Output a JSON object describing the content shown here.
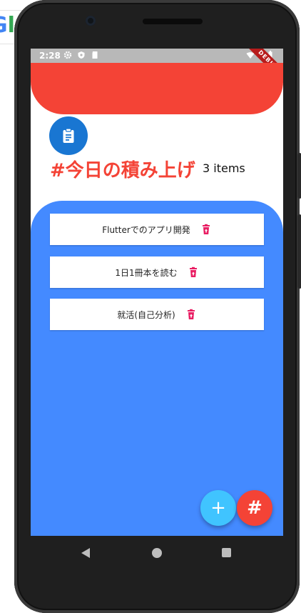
{
  "status_bar": {
    "time": "2:28",
    "debug_banner": "DEBUG"
  },
  "header": {
    "title": "#今日の積み上げ",
    "item_count": "3 items"
  },
  "tasks": [
    {
      "label": "Flutterでのアプリ開発"
    },
    {
      "label": "1日1冊本を読む"
    },
    {
      "label": "就活(自己分析)"
    }
  ],
  "fabs": {
    "add_symbol": "+",
    "hash_symbol": "#"
  },
  "colors": {
    "accent_red": "#f44336",
    "panel_blue": "#448aff",
    "avatar_blue": "#1976d2",
    "fab_light_blue": "#40c4ff",
    "trash_pink": "#e91e63"
  },
  "icons": {
    "avatar": "clipboard-icon",
    "task_action": "delete-icon",
    "nav_back": "back-triangle-icon",
    "nav_home": "home-circle-icon",
    "nav_recent": "recent-square-icon"
  }
}
